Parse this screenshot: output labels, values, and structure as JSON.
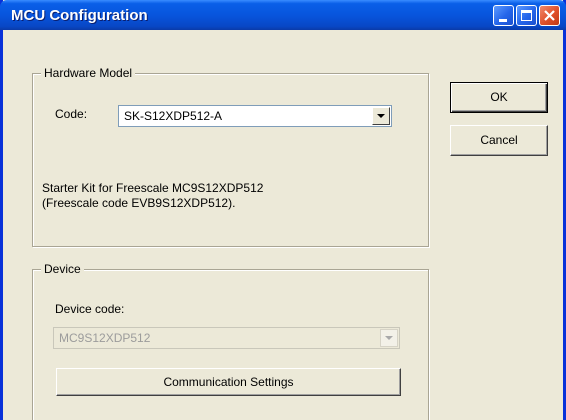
{
  "window": {
    "title": "MCU Configuration"
  },
  "titlebar_buttons": {
    "minimize": "minimize-icon",
    "maximize": "maximize-icon",
    "close": "close-icon"
  },
  "hardware_model": {
    "legend": "Hardware Model",
    "code_label": "Code:",
    "code_value": "SK-S12XDP512-A",
    "description_line1": "Starter Kit for Freescale MC9S12XDP512",
    "description_line2": "(Freescale code EVB9S12XDP512)."
  },
  "device": {
    "legend": "Device",
    "device_code_label": "Device code:",
    "device_code_value": "MC9S12XDP512",
    "comm_button_label": "Communication Settings"
  },
  "actions": {
    "ok_label": "OK",
    "cancel_label": "Cancel"
  }
}
